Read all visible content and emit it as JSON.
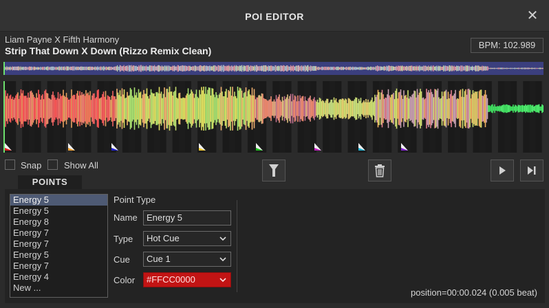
{
  "window": {
    "title": "POI EDITOR"
  },
  "track": {
    "artist": "Liam Payne X Fifth Harmony",
    "title": "Strip That Down X Down (Rizzo Remix Clean)",
    "bpm_label": "BPM: 102.989"
  },
  "colors": {
    "overview_bg": "#3b3f7e",
    "cursor": "#6de06d",
    "selection": "#4e5a74",
    "color_field": "#c21414"
  },
  "waveform": {
    "markers": [
      {
        "color": "#e02020"
      },
      {
        "color": "#f0a030"
      },
      {
        "color": "#2020d0"
      },
      {
        "color": "#f0c830"
      },
      {
        "color": "#20c020"
      },
      {
        "color": "#c020c0"
      },
      {
        "color": "#20b0d0"
      },
      {
        "color": "#8020d0"
      }
    ]
  },
  "controls": {
    "snap_label": "Snap",
    "show_all_label": "Show All"
  },
  "tabs": {
    "points": "POINTS"
  },
  "points": {
    "items": [
      "Energy 5",
      "Energy 5",
      "Energy 8",
      "Energy 7",
      "Energy 7",
      "Energy 5",
      "Energy 7",
      "Energy 4",
      "New ..."
    ],
    "selected_index": 0
  },
  "editor": {
    "section_label": "Point Type",
    "name_label": "Name",
    "name_value": "Energy 5",
    "type_label": "Type",
    "type_value": "Hot Cue",
    "cue_label": "Cue",
    "cue_value": "Cue 1",
    "color_label": "Color",
    "color_value": "#FFCC0000"
  },
  "status": {
    "position": "position=00:00.024 (0.005 beat)"
  }
}
